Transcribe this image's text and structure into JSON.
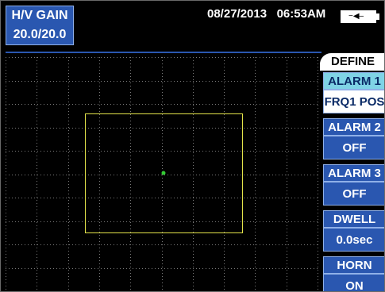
{
  "gain": {
    "title": "H/V GAIN",
    "value": "20.0/20.0"
  },
  "status": {
    "date": "08/27/2013",
    "time": "06:53AM",
    "battery_icon": "battery-plugged-icon"
  },
  "menu": {
    "tab": "DEFINE",
    "buttons": [
      {
        "label": "ALARM 1",
        "value": "FRQ1 POS",
        "active": true
      },
      {
        "label": "ALARM 2",
        "value": "OFF",
        "active": false
      },
      {
        "label": "ALARM 3",
        "value": "OFF",
        "active": false
      },
      {
        "label": "DWELL",
        "value": "0.0sec",
        "active": false
      },
      {
        "label": "HORN",
        "value": "ON",
        "active": false
      }
    ]
  },
  "colors": {
    "grid": "#7a7a7a",
    "alarm_box": "#e3e34a",
    "signal_dot": "#33cc33",
    "button_bg": "#2a57b0",
    "active_label_bg": "#7fd3e6"
  }
}
